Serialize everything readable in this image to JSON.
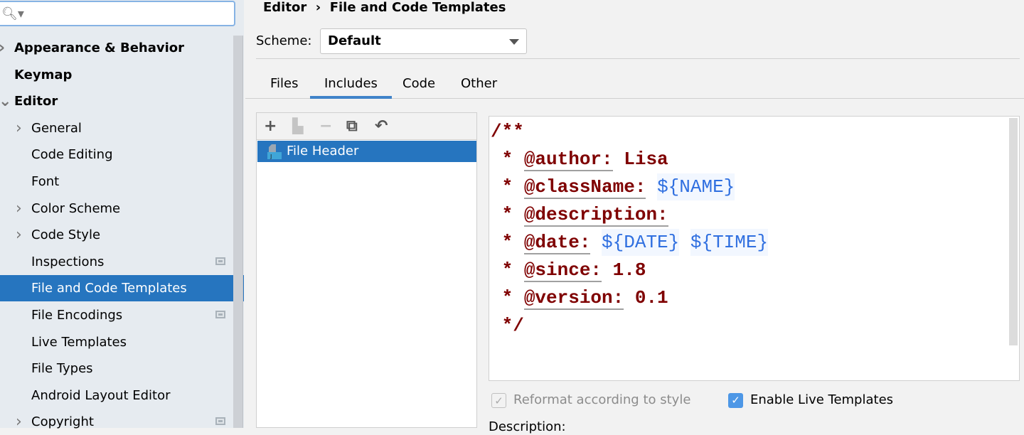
{
  "sidebar": {
    "search": {
      "value": "",
      "icon": "search-icon"
    },
    "items": [
      {
        "label": "Appearance & Behavior",
        "level": 0,
        "arrow": "collapsed"
      },
      {
        "label": "Keymap",
        "level": 0
      },
      {
        "label": "Editor",
        "level": 0,
        "arrow": "expanded"
      },
      {
        "label": "General",
        "level": 1,
        "arrow": "collapsed"
      },
      {
        "label": "Code Editing",
        "level": 1
      },
      {
        "label": "Font",
        "level": 1
      },
      {
        "label": "Color Scheme",
        "level": 1,
        "arrow": "collapsed"
      },
      {
        "label": "Code Style",
        "level": 1,
        "arrow": "collapsed"
      },
      {
        "label": "Inspections",
        "level": 1,
        "project_icon": true
      },
      {
        "label": "File and Code Templates",
        "level": 1,
        "selected": true
      },
      {
        "label": "File Encodings",
        "level": 1,
        "project_icon": true
      },
      {
        "label": "Live Templates",
        "level": 1
      },
      {
        "label": "File Types",
        "level": 1
      },
      {
        "label": "Android Layout Editor",
        "level": 1
      },
      {
        "label": "Copyright",
        "level": 1,
        "arrow": "collapsed",
        "project_icon": true
      }
    ]
  },
  "breadcrumb": {
    "parent": "Editor",
    "separator": "›",
    "current": "File and Code Templates"
  },
  "scheme": {
    "label": "Scheme:",
    "value": "Default"
  },
  "tabs": [
    {
      "label": "Files"
    },
    {
      "label": "Includes",
      "active": true
    },
    {
      "label": "Code"
    },
    {
      "label": "Other"
    }
  ],
  "toolbar": {
    "add": "+",
    "copy": "⧉",
    "remove": "−",
    "reset": "↶"
  },
  "templates": [
    {
      "label": "File Header",
      "selected": true
    }
  ],
  "editor": {
    "open": "/**",
    "author_tag": "@author:",
    "author": " Lisa",
    "classname_tag": "@className:",
    "classname_var": "${NAME}",
    "description_tag": "@description:",
    "date_tag": "@date:",
    "date_var": "${DATE}",
    "time_var": "${TIME}",
    "since_tag": "@since:",
    "since": " 1.8",
    "version_tag": "@version:",
    "version": " 0.1",
    "close": "*/"
  },
  "options": {
    "reformat": {
      "label": "Reformat according to style",
      "checked": true,
      "disabled": true
    },
    "live_templates": {
      "label": "Enable Live Templates",
      "checked": true
    }
  },
  "description_label": "Description:",
  "colors": {
    "selection": "#2675bf",
    "code_tag": "#7f0000",
    "code_var": "#2f6fe0"
  }
}
